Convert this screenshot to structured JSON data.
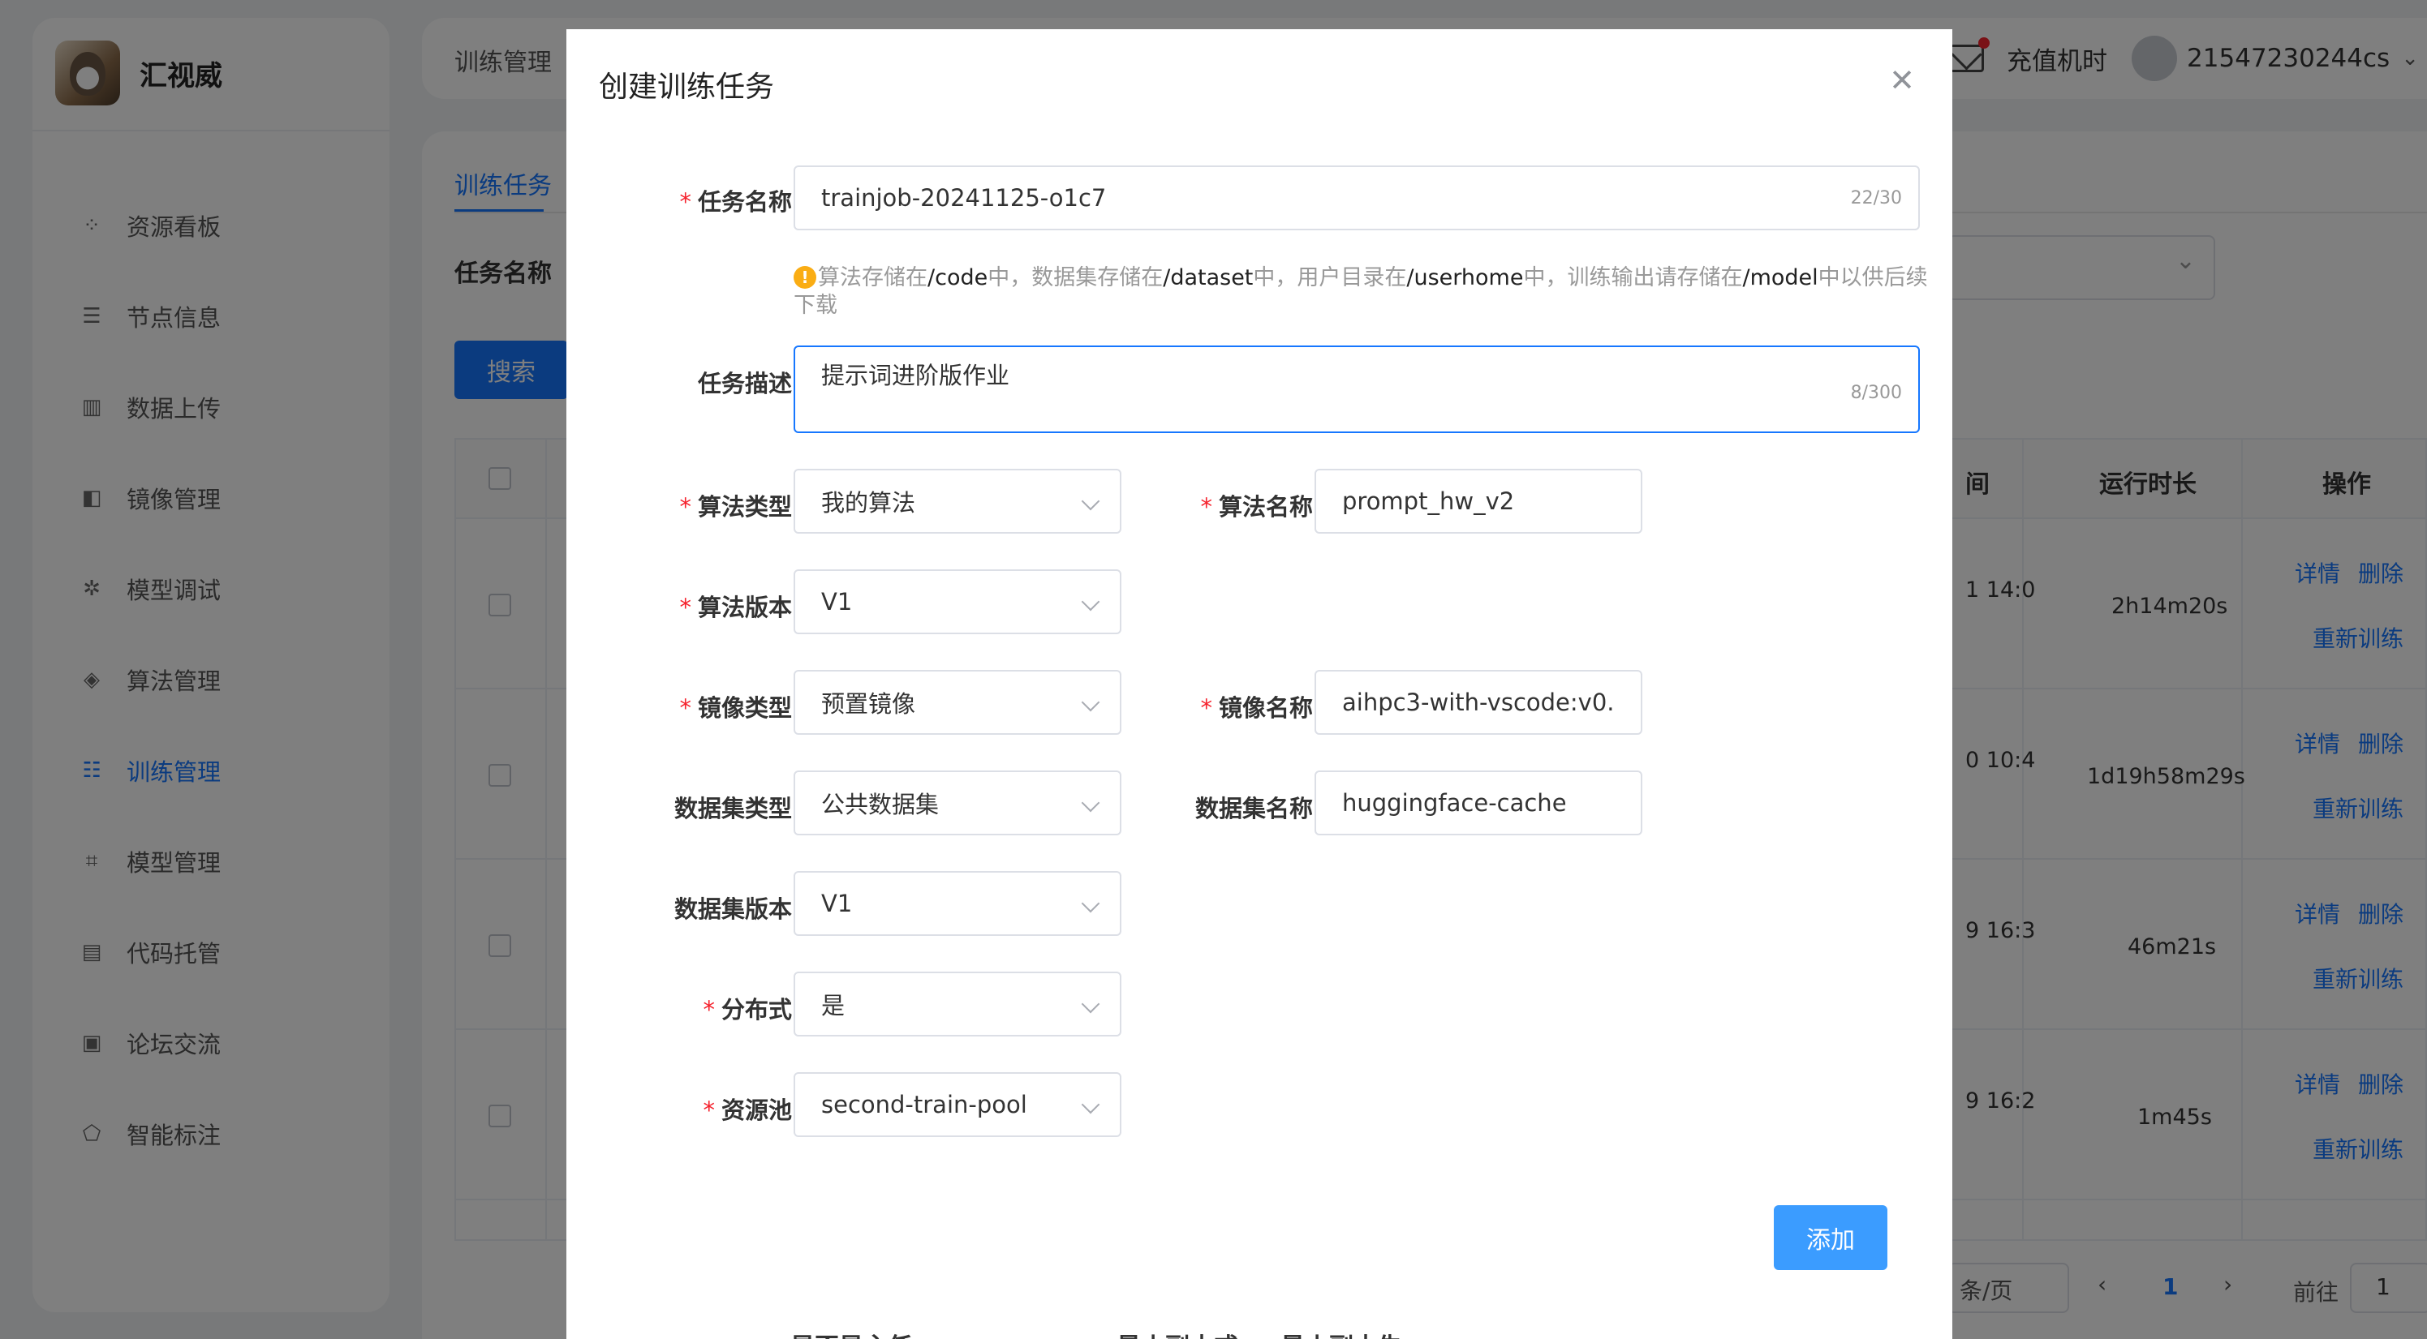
{
  "app": {
    "name": "汇视威"
  },
  "sidebar": {
    "items": [
      {
        "label": "资源看板",
        "icon": "grid-icon"
      },
      {
        "label": "节点信息",
        "icon": "sliders-icon"
      },
      {
        "label": "数据上传",
        "icon": "bar-chart-icon"
      },
      {
        "label": "镜像管理",
        "icon": "image-icon"
      },
      {
        "label": "模型调试",
        "icon": "debug-icon"
      },
      {
        "label": "算法管理",
        "icon": "algorithm-icon"
      },
      {
        "label": "训练管理",
        "icon": "list-icon",
        "active": true
      },
      {
        "label": "模型管理",
        "icon": "model-icon"
      },
      {
        "label": "代码托管",
        "icon": "code-icon"
      },
      {
        "label": "论坛交流",
        "icon": "chat-icon"
      },
      {
        "label": "智能标注",
        "icon": "tag-icon"
      }
    ]
  },
  "header": {
    "breadcrumb": "训练管理",
    "recharge": "充值机时",
    "username": "21547230244cs"
  },
  "page": {
    "tab": "训练任务",
    "filter_label": "任务名称",
    "search_button": "搜索",
    "columns": {
      "time_partial": "间",
      "duration": "运行时长",
      "actions": "操作"
    },
    "rows": [
      {
        "time": "1 14:0",
        "duration": "2h14m20s"
      },
      {
        "time": "0 10:4",
        "duration": "1d19h58m29s"
      },
      {
        "time": "9 16:3",
        "duration": "46m21s"
      },
      {
        "time": "9 16:2",
        "duration": "1m45s"
      }
    ],
    "actions": {
      "detail": "详情",
      "delete": "删除",
      "retrain": "重新训练"
    },
    "pager": {
      "page_size": "条/页",
      "current": "1",
      "goto": "前往",
      "goto_value": "1"
    }
  },
  "modal": {
    "title": "创建训练任务",
    "fields": {
      "task_name": {
        "label": "任务名称",
        "value": "trainjob-20241125-o1c7",
        "count": "22/30"
      },
      "hint": {
        "p1": "算法存储在",
        "code": "/code",
        "p2": "中，数据集存储在",
        "dataset": "/dataset",
        "p3": "中，用户目录在",
        "userhome": "/userhome",
        "p4": "中，训练输出请存储在",
        "model": "/model",
        "p5": "中以供后续下载"
      },
      "task_desc": {
        "label": "任务描述",
        "value": "提示词进阶版作业",
        "count": "8/300"
      },
      "algo_type": {
        "label": "算法类型",
        "value": "我的算法"
      },
      "algo_name": {
        "label": "算法名称",
        "value": "prompt_hw_v2"
      },
      "algo_version": {
        "label": "算法版本",
        "value": "V1"
      },
      "image_type": {
        "label": "镜像类型",
        "value": "预置镜像"
      },
      "image_name": {
        "label": "镜像名称",
        "value": "aihpc3-with-vscode:v0."
      },
      "dataset_type": {
        "label": "数据集类型",
        "value": "公共数据集"
      },
      "dataset_name": {
        "label": "数据集名称",
        "value": "huggingface-cache"
      },
      "dataset_version": {
        "label": "数据集版本",
        "value": "V1"
      },
      "distributed": {
        "label": "分布式",
        "value": "是"
      },
      "resource_pool": {
        "label": "资源池",
        "value": "second-train-pool"
      }
    },
    "add_button": "添加",
    "cut_labels": [
      "是否是主任",
      "最小副本或",
      "最小副本失"
    ]
  }
}
